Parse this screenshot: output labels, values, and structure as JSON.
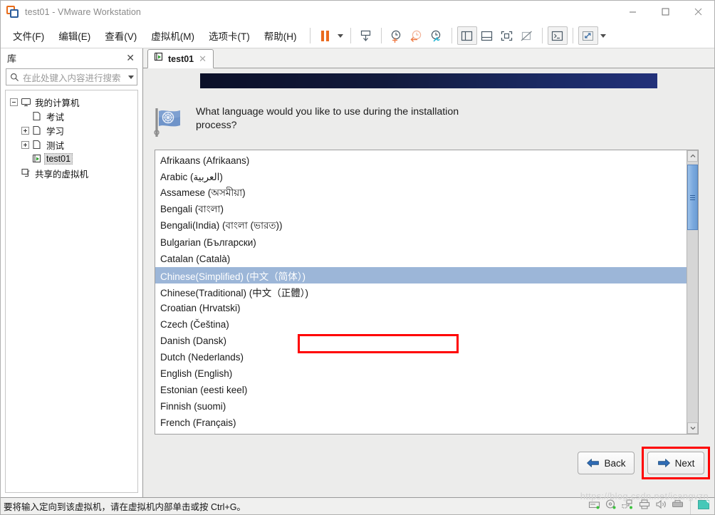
{
  "window": {
    "title": "test01 - VMware Workstation",
    "logo_icon": "vmware-logo-icon",
    "minimize_label": "minimize",
    "maximize_label": "maximize",
    "close_label": "close"
  },
  "menubar": {
    "items": [
      {
        "label": "文件(F)",
        "name": "menu-file"
      },
      {
        "label": "编辑(E)",
        "name": "menu-edit"
      },
      {
        "label": "查看(V)",
        "name": "menu-view"
      },
      {
        "label": "虚拟机(M)",
        "name": "menu-vm"
      },
      {
        "label": "选项卡(T)",
        "name": "menu-tabs"
      },
      {
        "label": "帮助(H)",
        "name": "menu-help"
      }
    ]
  },
  "toolbar": {
    "buttons": [
      "pause-icon",
      "pause-dropdown-caret",
      "send-ctrl-alt-del-icon",
      "take-snapshot-icon",
      "revert-snapshot-icon",
      "manage-snapshots-icon",
      "show-library-icon",
      "show-thumbnails-icon",
      "full-screen-icon",
      "unity-mode-icon",
      "console-view-icon",
      "stretch-view-icon",
      "stretch-dropdown-caret"
    ]
  },
  "sidebar": {
    "title": "库",
    "close_icon": "close-icon",
    "search": {
      "placeholder": "在此处键入内容进行搜索",
      "search_icon": "search-icon",
      "dropdown_icon": "chevron-down-icon"
    },
    "tree": [
      {
        "label": "我的计算机",
        "icon": "computer-icon",
        "level": 0,
        "expander": "minus",
        "selected": false
      },
      {
        "label": "考试",
        "icon": "folder-icon",
        "level": 1,
        "expander": "none",
        "selected": false
      },
      {
        "label": "学习",
        "icon": "folder-icon",
        "level": 1,
        "expander": "plus",
        "selected": false
      },
      {
        "label": "测试",
        "icon": "folder-icon",
        "level": 1,
        "expander": "plus",
        "selected": false
      },
      {
        "label": "test01",
        "icon": "vm-running-icon",
        "level": 1,
        "expander": "none",
        "selected": true
      },
      {
        "label": "共享的虚拟机",
        "icon": "shared-vms-icon",
        "level": 0,
        "expander": "none",
        "selected": false
      }
    ]
  },
  "tabs": [
    {
      "label": "test01",
      "icon": "vm-running-icon",
      "active": true,
      "close_icon": "close-icon"
    }
  ],
  "guest": {
    "banner_colors": [
      "#0b1028",
      "#22317a"
    ],
    "flag_icon": "un-flag-icon",
    "prompt": "What language would you like to use during the installation process?",
    "languages": [
      "Afrikaans (Afrikaans)",
      "Arabic (العربية)",
      "Assamese (অসমীয়া)",
      "Bengali (বাংলা)",
      "Bengali(India) (বাংলা (ভারত))",
      "Bulgarian (Български)",
      "Catalan (Català)",
      "Chinese(Simplified) (中文（简体）)",
      "Chinese(Traditional) (中文（正體）)",
      "Croatian (Hrvatski)",
      "Czech (Čeština)",
      "Danish (Dansk)",
      "Dutch (Nederlands)",
      "English (English)",
      "Estonian (eesti keel)",
      "Finnish (suomi)",
      "French (Français)"
    ],
    "selected_language": "Chinese(Simplified) (中文（简体）)",
    "selected_index": 7,
    "selection_color": "#9cb6d8",
    "highlight_color": "#ff0000",
    "scrollbar": {
      "up_icon": "chevron-up-icon",
      "down_icon": "chevron-down-icon",
      "thumb_color": "#7aa9de"
    },
    "buttons": {
      "back": {
        "label": "Back",
        "icon": "arrow-left-icon",
        "highlighted": false
      },
      "next": {
        "label": "Next",
        "icon": "arrow-right-icon",
        "highlighted": true
      }
    }
  },
  "statusbar": {
    "message": "要将输入定向到该虚拟机，请在虚拟机内部单击或按 Ctrl+G。",
    "watermark": "https://blog.csdn.net/icangvzn",
    "devices": [
      "hard-disk-icon",
      "cd-dvd-icon",
      "network-adapter-icon",
      "printer-icon",
      "sound-card-icon",
      "usb-controller-icon",
      "display-icon"
    ]
  }
}
